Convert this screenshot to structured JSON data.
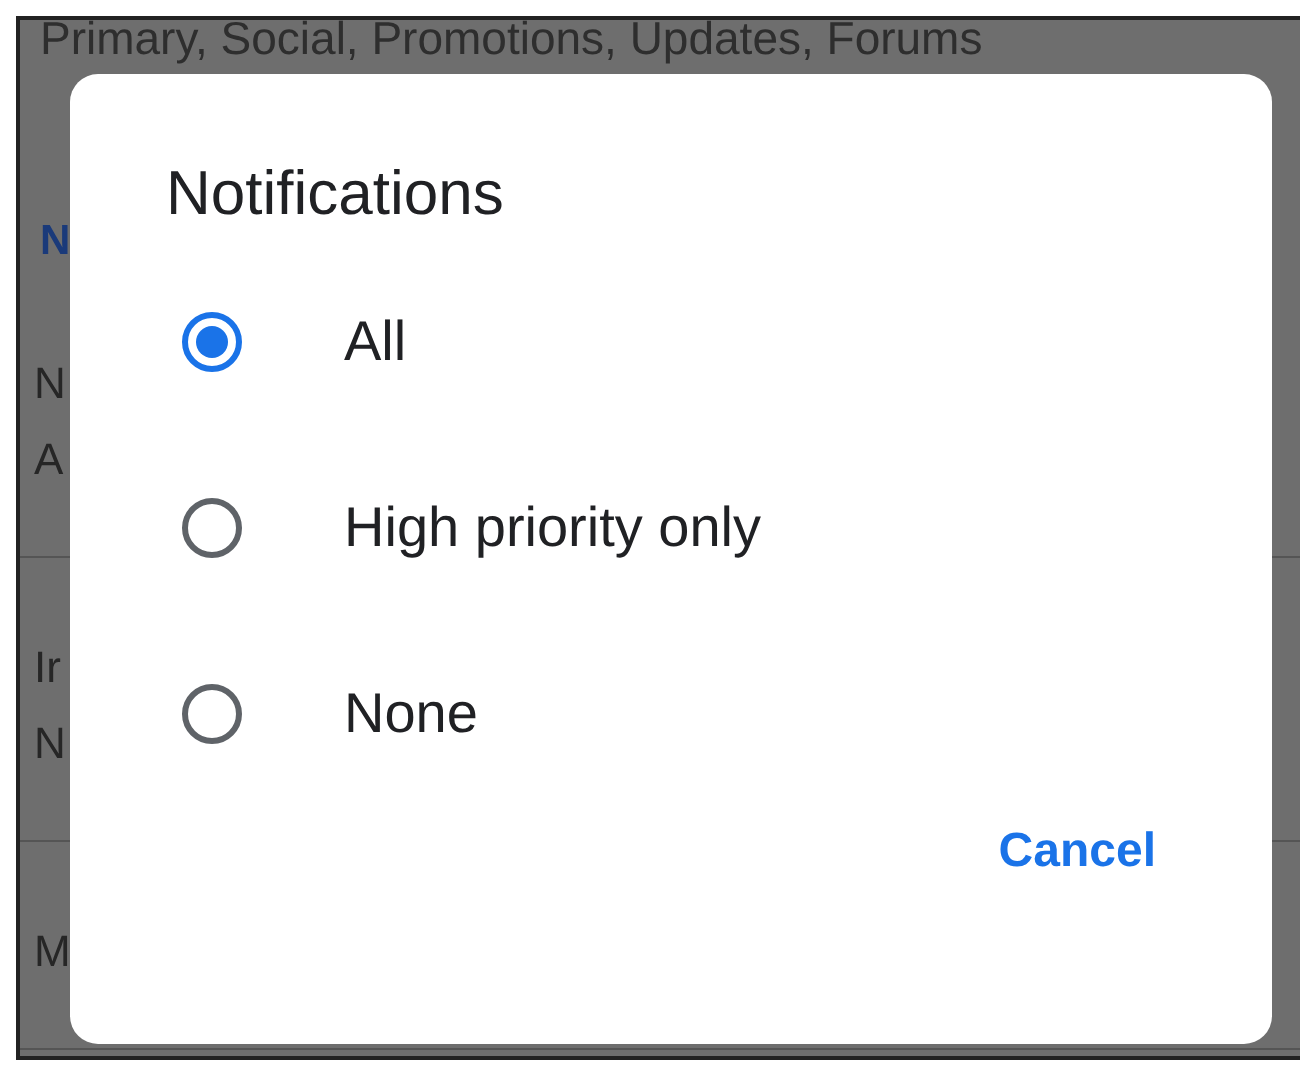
{
  "background": {
    "top_line": "Primary, Social, Promotions, Updates, Forums",
    "section_header": "N",
    "sections": [
      {
        "title": "N",
        "subtitle": "A"
      },
      {
        "title": "Ir",
        "subtitle": "N"
      },
      {
        "title": "M"
      }
    ]
  },
  "dialog": {
    "title": "Notifications",
    "options": [
      {
        "label": "All",
        "selected": true
      },
      {
        "label": "High priority only",
        "selected": false
      },
      {
        "label": "None",
        "selected": false
      }
    ],
    "buttons": [
      "Cancel"
    ]
  }
}
